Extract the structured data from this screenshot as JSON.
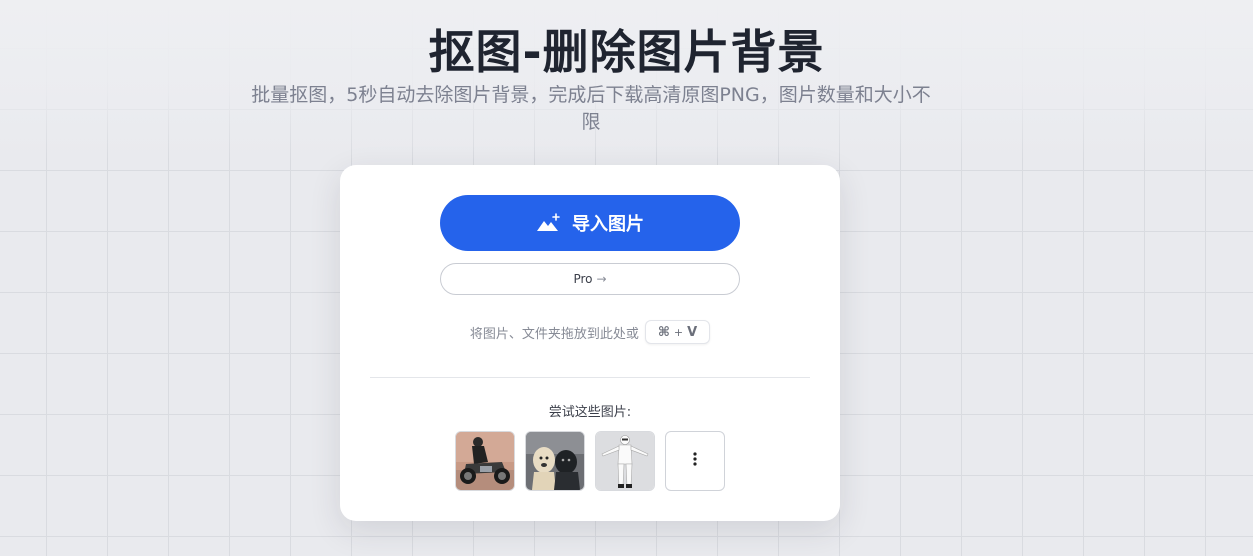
{
  "header": {
    "title": "抠图-删除图片背景",
    "subtitle": "批量抠图，5秒自动去除图片背景，完成后下载高清原图PNG，图片数量和大小不限"
  },
  "upload": {
    "button_label": "导入图片",
    "button_icon": "image-add-icon",
    "pro_label": "Pro",
    "pro_arrow": "→",
    "drop_hint": "将图片、文件夹拖放到此处或",
    "shortcut_symbol": "⌘",
    "shortcut_sep": "+",
    "shortcut_key": "V"
  },
  "samples": {
    "label": "尝试这些图片:",
    "items": [
      {
        "name": "motorcycle-rider-image"
      },
      {
        "name": "dogs-image"
      },
      {
        "name": "white-suit-figure-image"
      }
    ],
    "more_icon": "more-vertical-icon"
  },
  "colors": {
    "accent": "#2563eb",
    "title": "#1f2430",
    "subtitle": "#7d8190",
    "background": "#e9eaee"
  }
}
